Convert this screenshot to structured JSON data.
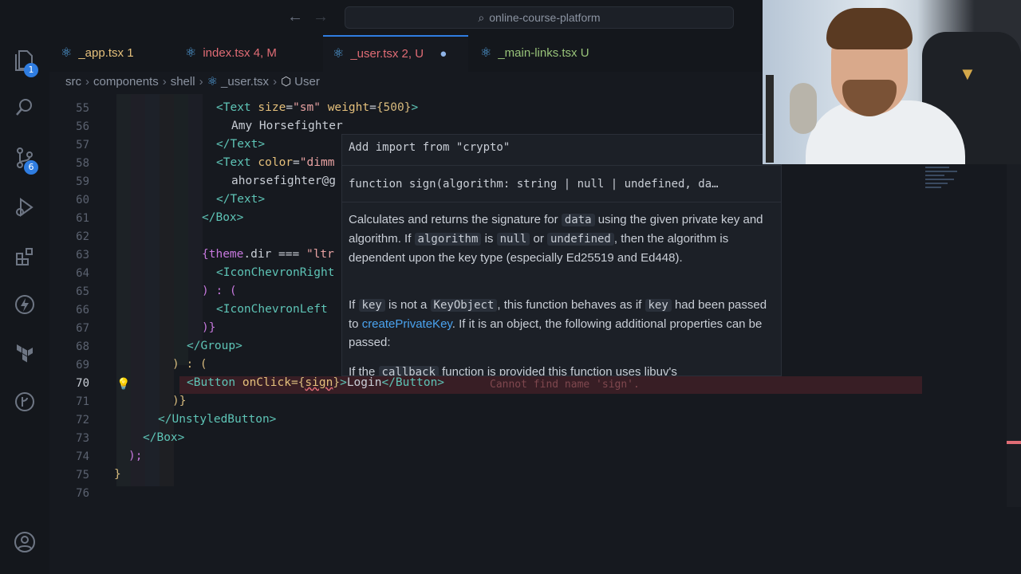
{
  "window": {
    "search_text": "online-course-platform"
  },
  "activity_bar": {
    "explorer_badge": "1",
    "scm_badge": "6"
  },
  "tabs": [
    {
      "name": "_app.tsx",
      "status": "1",
      "color": "#e5c07b"
    },
    {
      "name": "index.tsx",
      "status": "4, M",
      "color": "#e06c75"
    },
    {
      "name": "_user.tsx",
      "status": "2, U",
      "color": "#e06c75"
    },
    {
      "name": "_main-links.tsx",
      "status": "U",
      "color": "#98c379"
    }
  ],
  "breadcrumb": {
    "items": [
      "src",
      "components",
      "shell",
      "_user.tsx",
      "User"
    ]
  },
  "editor": {
    "line_numbers": [
      "55",
      "56",
      "57",
      "58",
      "59",
      "60",
      "61",
      "62",
      "63",
      "64",
      "65",
      "66",
      "67",
      "68",
      "69",
      "70",
      "71",
      "72",
      "73",
      "74",
      "75",
      "76"
    ],
    "lines": {
      "l55": {
        "t1": "<Text",
        "a1": "size",
        "s1": "\"sm\"",
        "a2": "weight",
        "b1": "{500}",
        "t2": ">"
      },
      "l56": "Amy Horsefighter",
      "l57": "</Text>",
      "l58": {
        "t1": "<Text",
        "a1": "color",
        "s1": "\"dimm"
      },
      "l59": "ahorsefighter@g",
      "l60": "</Text>",
      "l61": "</Box>",
      "l63": {
        "b1": "{",
        "p1": "theme",
        "p2": ".dir",
        "op": " === ",
        "s1": "\"ltr"
      },
      "l64": "<IconChevronRight",
      "l65": ") : (",
      "l66": "<IconChevronLeft",
      "l67": ")}",
      "l68": "</Group>",
      "l69": ") : (",
      "l70": {
        "t1": "<Button",
        "a1": "onClick",
        "b1": "={",
        "fn": "sign",
        "b2": "}",
        "t2": ">",
        "text": "Login",
        "t3": "</Button>"
      },
      "l71": ")}",
      "l72": "</UnstyledButton>",
      "l73": "</Box>",
      "l74": ");",
      "l75": "}"
    },
    "error_message": "Cannot find name 'sign'."
  },
  "hover": {
    "quick_fix": "Add import from \"crypto\"",
    "signature": "function sign(algorithm: string | null | undefined, da…",
    "p1": {
      "a": "Calculates and returns the signature for",
      "c1": "data",
      "b": "using the given private key and algorithm. If",
      "c2": "algorithm",
      "c": "is",
      "c3": "null",
      "d": "or",
      "c4": "undefined",
      "e": ", then the algorithm is dependent upon the key type (especially Ed25519 and Ed448)."
    },
    "p2": {
      "a": "If",
      "c1": "key",
      "b": "is not a",
      "c2": "KeyObject",
      "c": ", this function behaves as if",
      "c3": "key",
      "d": "had been passed to",
      "link": "createPrivateKey",
      "e": ". If it is an object, the following additional properties can be passed:"
    },
    "p3": {
      "a": "If the",
      "c1": "callback",
      "b": "function is provided this function uses libuv's"
    }
  }
}
